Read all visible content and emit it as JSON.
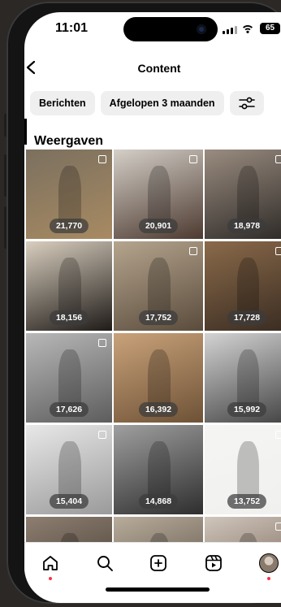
{
  "status_bar": {
    "time": "11:01",
    "battery": "65"
  },
  "nav": {
    "back_label": "",
    "title": "Content"
  },
  "filters": [
    {
      "label": "Berichten"
    },
    {
      "label": "Afgelopen 3 maanden"
    }
  ],
  "section": {
    "title": "Weergaven"
  },
  "posts": [
    {
      "views": "21,770",
      "multi": true,
      "colors": [
        "#7b705f",
        "#a88a62"
      ]
    },
    {
      "views": "20,901",
      "multi": true,
      "colors": [
        "#d4cfc8",
        "#4d3a30"
      ]
    },
    {
      "views": "18,978",
      "multi": true,
      "colors": [
        "#9a8c80",
        "#2e2a27"
      ]
    },
    {
      "views": "18,156",
      "multi": false,
      "colors": [
        "#d9cfbf",
        "#1f1b18"
      ]
    },
    {
      "views": "17,752",
      "multi": true,
      "colors": [
        "#b5a58e",
        "#5a4b3c"
      ]
    },
    {
      "views": "17,728",
      "multi": true,
      "colors": [
        "#8a6a4a",
        "#3a2c22"
      ]
    },
    {
      "views": "17,626",
      "multi": true,
      "colors": [
        "#b8b8b8",
        "#5d5d5d"
      ]
    },
    {
      "views": "16,392",
      "multi": false,
      "colors": [
        "#c9a27a",
        "#6e5236"
      ]
    },
    {
      "views": "15,992",
      "multi": false,
      "colors": [
        "#d3d3d3",
        "#444444"
      ]
    },
    {
      "views": "15,404",
      "multi": true,
      "colors": [
        "#e8e8e8",
        "#9a9a9a"
      ]
    },
    {
      "views": "14,868",
      "multi": false,
      "colors": [
        "#9f9f9f",
        "#2e2e2e"
      ]
    },
    {
      "views": "13,752",
      "multi": true,
      "colors": [
        "#f5f5f3",
        "#f0f0ee"
      ]
    },
    {
      "views": "",
      "multi": false,
      "colors": [
        "#8d7e70",
        "#3d332c"
      ]
    },
    {
      "views": "",
      "multi": false,
      "colors": [
        "#b8ac9c",
        "#4f4439"
      ]
    },
    {
      "views": "",
      "multi": true,
      "colors": [
        "#cfc6bc",
        "#6d5448"
      ]
    }
  ],
  "tabs": [
    {
      "icon": "home-icon"
    },
    {
      "icon": "search-icon"
    },
    {
      "icon": "create-icon"
    },
    {
      "icon": "reels-icon"
    },
    {
      "icon": "profile-avatar"
    }
  ]
}
